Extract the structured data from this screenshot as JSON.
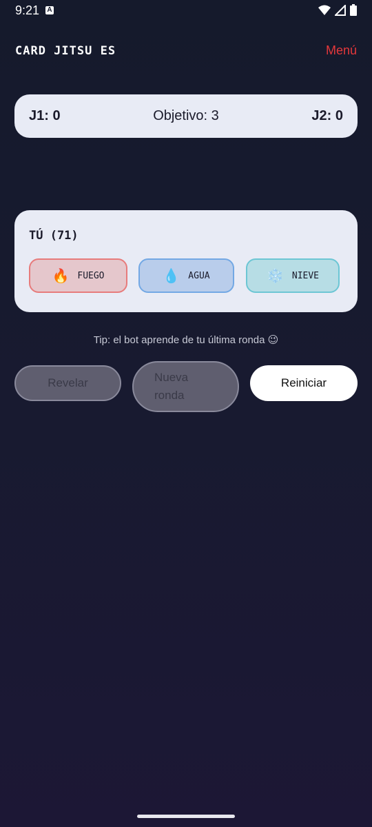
{
  "status_bar": {
    "time": "9:21",
    "a_icon_glyph": "A"
  },
  "header": {
    "title": "CARD JITSU ES",
    "menu_label": "Menú"
  },
  "score": {
    "p1": "J1: 0",
    "objective": "Objetivo: 3",
    "p2": "J2: 0"
  },
  "player": {
    "title": "TÚ (71)",
    "choices": [
      {
        "label": "FUEGO",
        "icon": "🔥",
        "icon_name": "fire-icon",
        "color": "#e77b7b"
      },
      {
        "label": "AGUA",
        "icon": "💧",
        "icon_name": "water-drop-icon",
        "color": "#73a8e4"
      },
      {
        "label": "NIEVE",
        "icon": "❄️",
        "icon_name": "snowflake-icon",
        "color": "#6cc6d4"
      }
    ]
  },
  "tip": "Tip: el bot aprende de tu última ronda 😉",
  "buttons": {
    "reveal": "Revelar",
    "new_round": "Nueva ronda",
    "reset": "Reiniciar"
  },
  "colors": {
    "accent": "#e5383b",
    "card_bg": "#e8ebf5"
  }
}
